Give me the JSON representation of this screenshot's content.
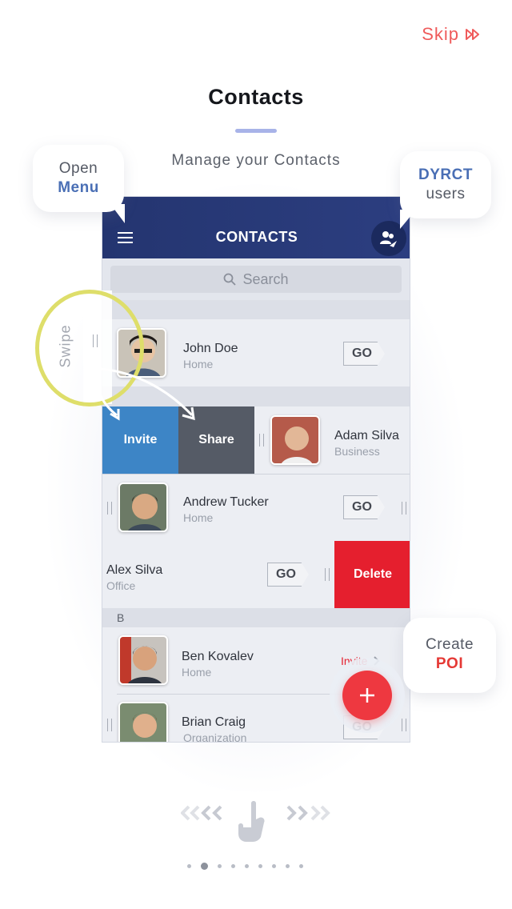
{
  "skip": {
    "label": "Skip"
  },
  "header": {
    "title": "Contacts",
    "subtitle": "Manage your Contacts"
  },
  "callouts": {
    "menu": {
      "line1": "Open",
      "line2": "Menu"
    },
    "dyrct": {
      "line1": "DYRCT",
      "line2": "users"
    },
    "poi": {
      "line1": "Create",
      "line2": "POI"
    },
    "swipe": "Swipe"
  },
  "app": {
    "title": "CONTACTS",
    "search_placeholder": "Search",
    "section_letter_b": "B",
    "actions": {
      "invite": "Invite",
      "share": "Share",
      "delete": "Delete",
      "go": "GO",
      "invite_link": "Invite"
    },
    "contacts": [
      {
        "name": "John Doe",
        "type": "Home"
      },
      {
        "name": "Adam Silva",
        "type": "Business"
      },
      {
        "name": "Andrew Tucker",
        "type": "Home"
      },
      {
        "name": "Alex Silva",
        "type": "Office"
      },
      {
        "name": "Ben Kovalev",
        "type": "Home"
      },
      {
        "name": "Brian Craig",
        "type": "Organization"
      }
    ]
  },
  "pager": {
    "total": 9,
    "active": 1
  },
  "colors": {
    "accent_red": "#e53935",
    "navy": "#243570",
    "blue": "#3d85c6"
  }
}
